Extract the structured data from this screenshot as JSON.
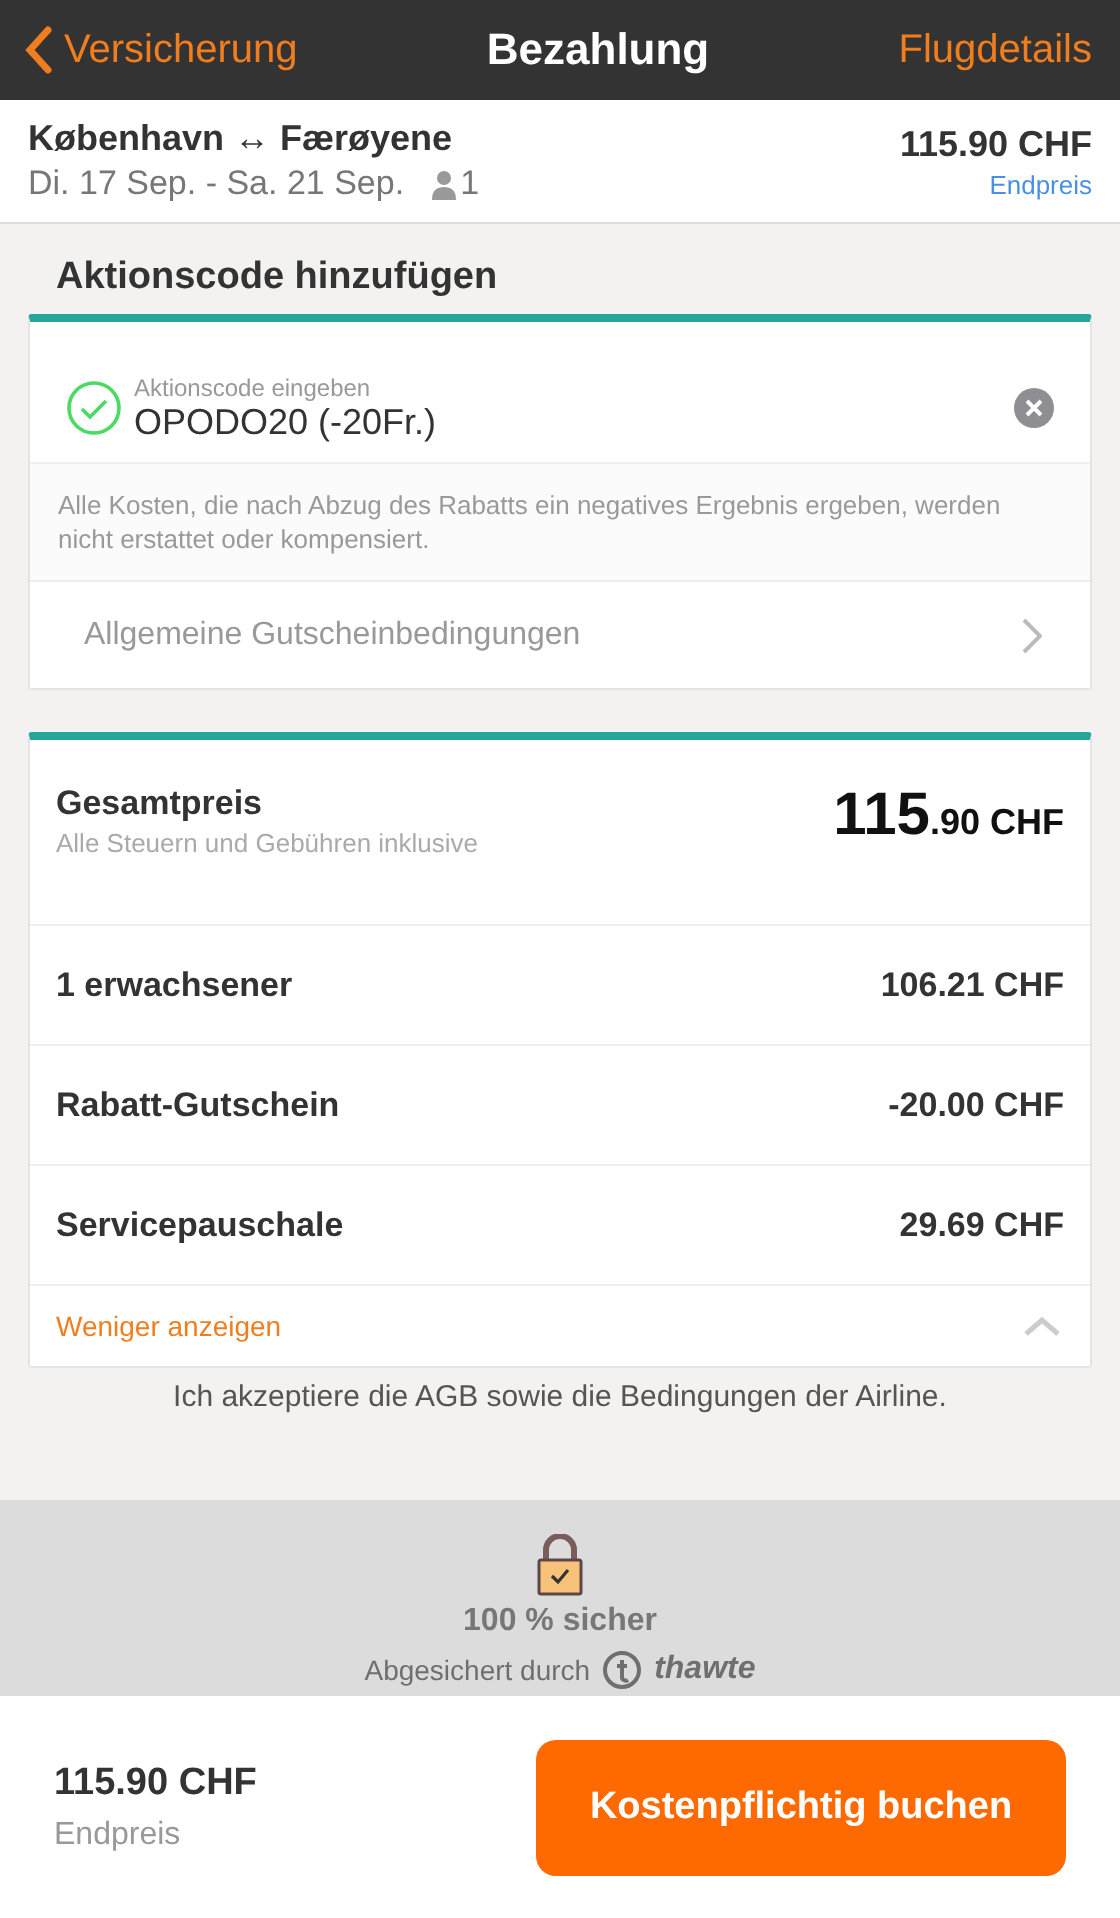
{
  "nav": {
    "back": "Versicherung",
    "title": "Bezahlung",
    "action": "Flugdetails"
  },
  "trip": {
    "route": "København ↔ Færøyene",
    "dates": "Di. 17 Sep. - Sa. 21 Sep.",
    "travellers": "1",
    "price": "115.90 CHF",
    "price_label": "Endpreis"
  },
  "promo": {
    "heading": "Aktionscode hinzufügen",
    "placeholder": "Aktionscode eingeben",
    "value": "OPODO20 (-20Fr.)",
    "valid": true,
    "note": "Alle Kosten, die nach Abzug des Rabatts ein negatives Ergebnis ergeben, werden nicht erstattet oder kompensiert.",
    "terms_link": "Allgemeine Gutscheinbedingungen"
  },
  "price_summary": {
    "rows": [
      {
        "kind": "total",
        "label": "Gesamtpreis",
        "sublabel": "Alle Steuern und Gebühren inklusive",
        "amount_main": "115",
        "amount_rest": ".90 CHF"
      },
      {
        "kind": "line",
        "label": "1 erwachsener",
        "amount": "106.21 CHF"
      },
      {
        "kind": "line",
        "label": "Rabatt-Gutschein",
        "amount": "-20.00 CHF"
      },
      {
        "kind": "line",
        "label": "Servicepauschale",
        "amount": "29.69 CHF"
      }
    ],
    "toggle": "Weniger anzeigen",
    "expanded": true
  },
  "terms_text": "Ich akzeptiere die AGB sowie die Bedingungen der Airline.",
  "security": {
    "title": "100 % sicher",
    "secured_by": "Abgesichert durch",
    "brand": "thawte"
  },
  "footer": {
    "price": "115.90 CHF",
    "price_label": "Endpreis",
    "button": "Kostenpflichtig buchen"
  }
}
